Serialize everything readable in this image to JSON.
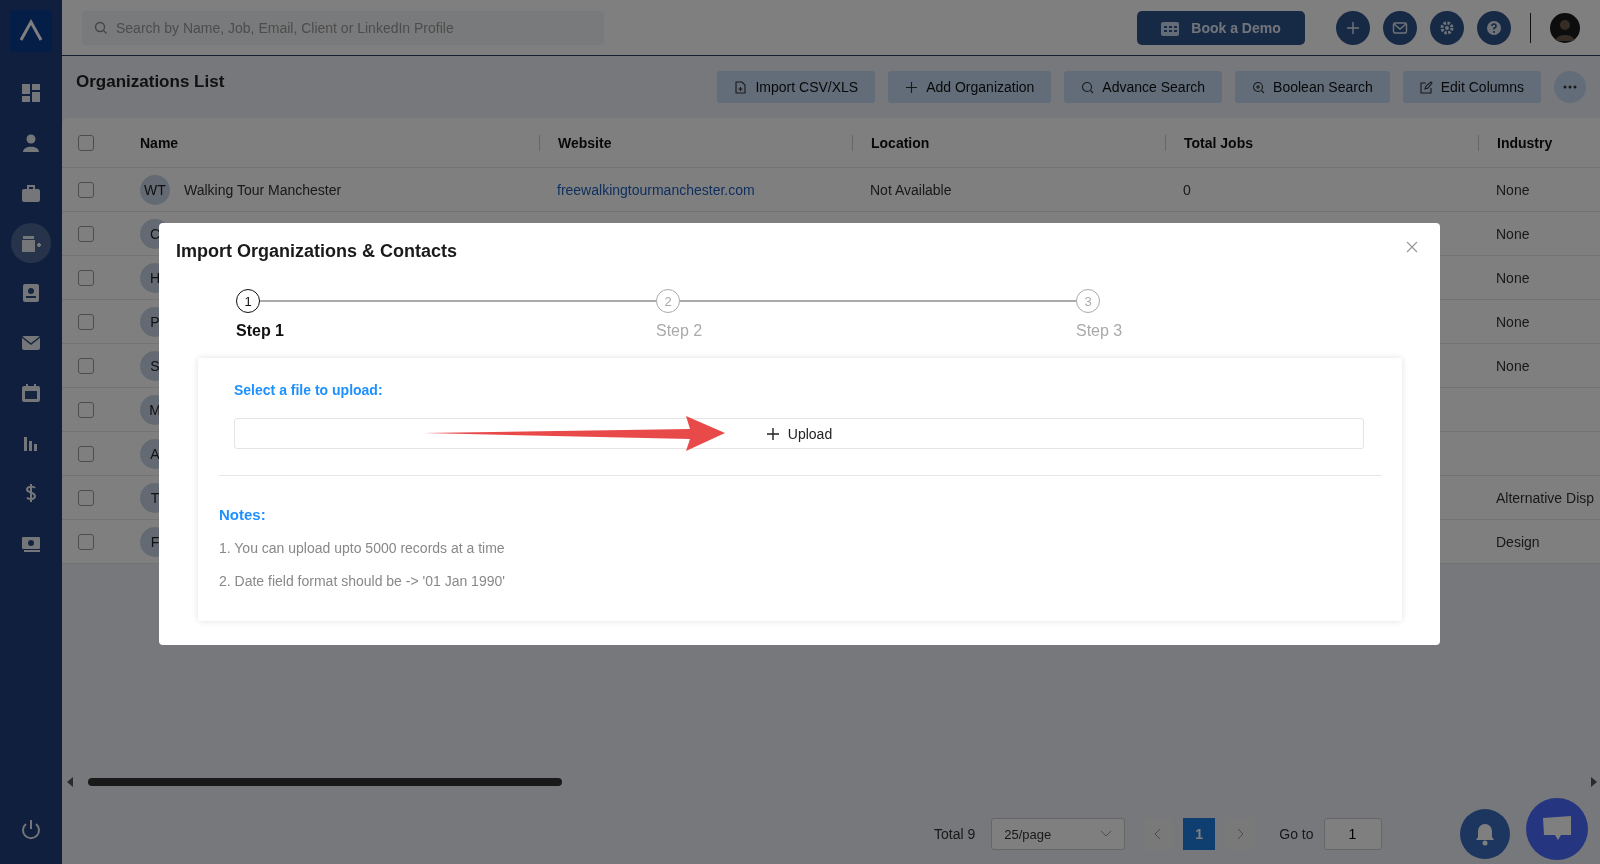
{
  "sidebar": {
    "items": [
      {
        "selected": false
      },
      {
        "selected": false
      },
      {
        "selected": false
      },
      {
        "selected": true
      },
      {
        "selected": false
      },
      {
        "selected": false
      },
      {
        "selected": false
      },
      {
        "selected": false
      },
      {
        "selected": false
      },
      {
        "selected": false
      }
    ]
  },
  "topbar": {
    "search": {
      "placeholder": "Search by Name, Job, Email, Client or LinkedIn Profile"
    },
    "demo_button": "Book a Demo"
  },
  "page": {
    "title": "Organizations List",
    "buttons": [
      "Import CSV/XLS",
      "Add Organization",
      "Advance Search",
      "Boolean Search",
      "Edit Columns"
    ]
  },
  "table": {
    "select_all": {
      "checked": false
    },
    "columns": [
      "Name",
      "Website",
      "Location",
      "Total Jobs",
      "Industry"
    ],
    "rows": [
      {
        "selected": false,
        "initials": "WT",
        "name": "Walking Tour Manchester",
        "website": "freewalkingtourmanchester.com",
        "location": "Not Available",
        "total_jobs": "0",
        "industry": "None"
      },
      {
        "selected": false,
        "initials": "C",
        "industry": "None"
      },
      {
        "selected": false,
        "initials": "H",
        "industry": "None"
      },
      {
        "selected": false,
        "initials": "P",
        "industry": "None"
      },
      {
        "selected": false,
        "initials": "S",
        "industry": "None"
      },
      {
        "selected": false,
        "initials": "M"
      },
      {
        "selected": false,
        "initials": "A"
      },
      {
        "selected": false,
        "initials": "T",
        "industry": "Alternative Disp"
      },
      {
        "selected": false,
        "initials": "F",
        "industry": "Design"
      }
    ]
  },
  "pagination": {
    "total": "Total 9",
    "page_size": "25/page",
    "pages": [
      {
        "label": "1",
        "selected": true
      }
    ],
    "goto_label": "Go to",
    "goto_value": "1"
  },
  "dialog": {
    "title": "Import Organizations & Contacts",
    "steps": [
      {
        "number": "1",
        "label": "Step 1",
        "selected": true
      },
      {
        "number": "2",
        "label": "Step 2",
        "selected": false
      },
      {
        "number": "3",
        "label": "Step 3",
        "selected": false
      }
    ],
    "upload_label": "Select a file to upload:",
    "upload_button": "Upload",
    "notes_title": "Notes:",
    "notes": [
      "1. You can upload upto 5000 records at a time",
      "2. Date field format should be -> '01 Jan 1990'"
    ]
  }
}
